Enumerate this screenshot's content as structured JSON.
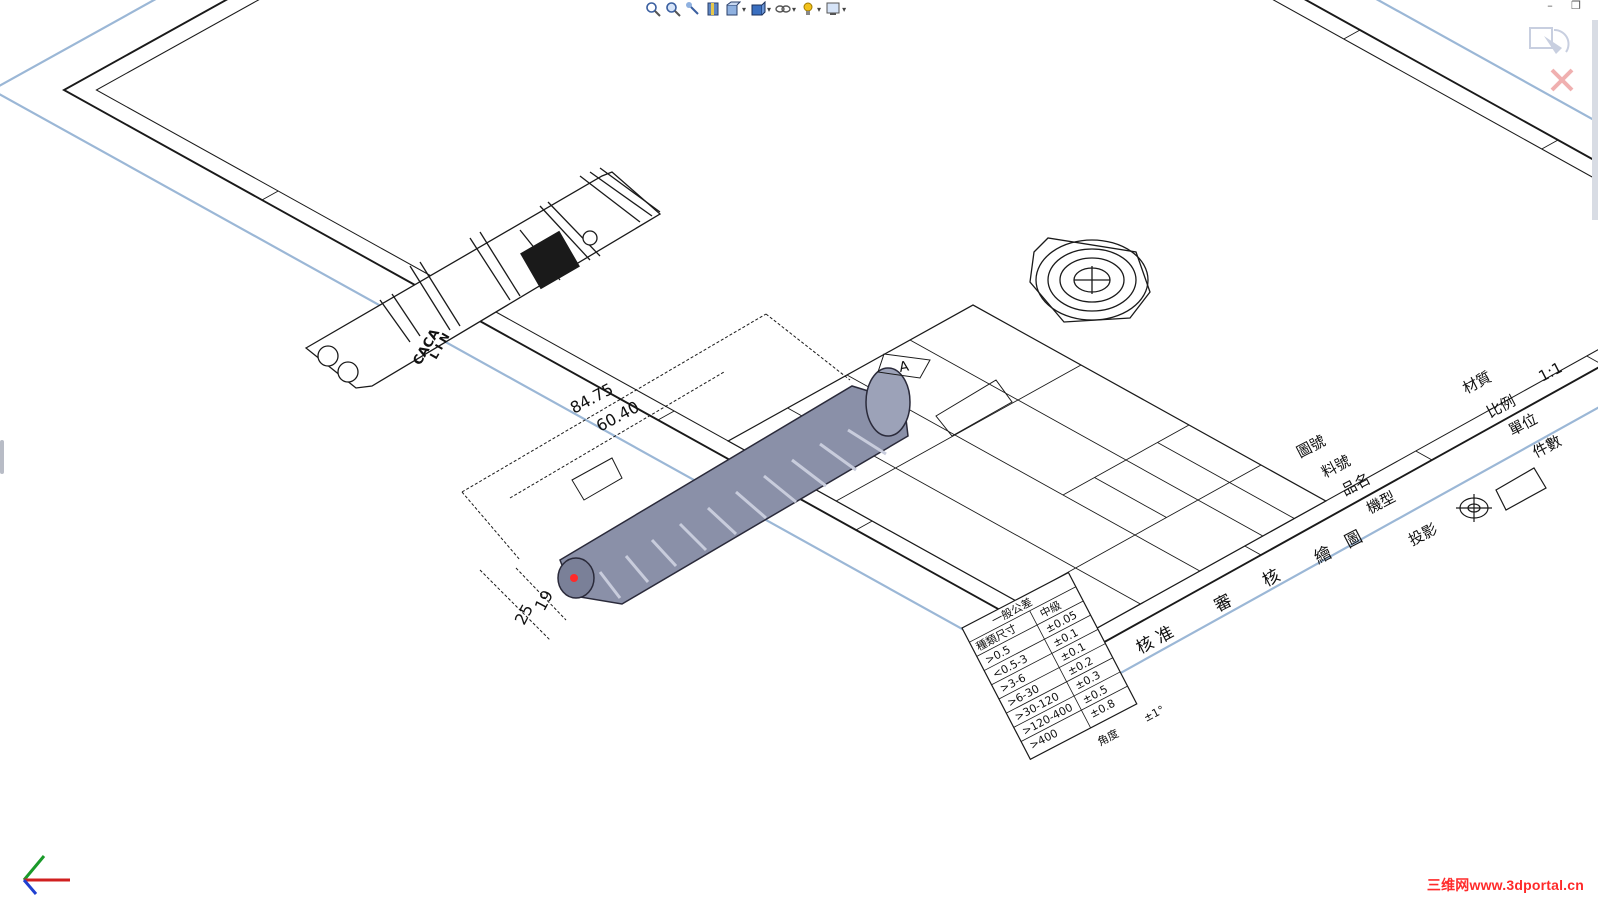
{
  "toolbar": {
    "buttons": [
      {
        "icon": "zoom-to-fit-icon",
        "dropdown": false
      },
      {
        "icon": "zoom-area-icon",
        "dropdown": false
      },
      {
        "icon": "previous-view-icon",
        "dropdown": false
      },
      {
        "icon": "section-view-icon",
        "dropdown": false
      },
      {
        "icon": "view-orientation-icon",
        "dropdown": true
      },
      {
        "icon": "display-style-icon",
        "dropdown": true
      },
      {
        "icon": "hide-show-items-icon",
        "dropdown": true
      },
      {
        "icon": "lights-icon",
        "dropdown": true
      },
      {
        "icon": "view-settings-icon",
        "dropdown": true
      }
    ],
    "dropdown_glyph": "▾"
  },
  "window": {
    "minimize": "–",
    "restore": "❐"
  },
  "drawing": {
    "dimensions": {
      "overall_length": "84.75",
      "body_length": "60.40",
      "diameter_small": "19",
      "diameter_large": "25"
    },
    "datum": "A",
    "part_marking": [
      "CACA",
      "L I N"
    ],
    "title_block": {
      "material_label": "材質",
      "material_value": "1:1",
      "scale_label": "比例",
      "unit_label": "單位",
      "quantity_label": "件數",
      "drawing_no_label": "圖號",
      "part_no_label": "料號",
      "name_label": "品名",
      "model_label": "機型",
      "projection_label": "投影",
      "draw_label": "繪 圖",
      "check_label": "審 核",
      "approve_label": "核 准"
    },
    "tolerance_table": {
      "title": "一般公差",
      "headers": [
        "種類尺寸",
        "中級"
      ],
      "rows": [
        [
          ">0.5",
          "±0.05"
        ],
        [
          "<0.5-3",
          "±0.1"
        ],
        [
          ">3-6",
          "±0.1"
        ],
        [
          ">6-30",
          "±0.2"
        ],
        [
          ">30-120",
          "±0.3"
        ],
        [
          ">120-400",
          "±0.5"
        ],
        [
          ">400",
          "±0.8"
        ],
        [
          "角度",
          "±1°"
        ]
      ]
    }
  },
  "watermark": "三维网www.3dportal.cn",
  "colors": {
    "accent": "#ff2a2a",
    "sheet_line": "#1a1a1a",
    "border_blue": "#9bb7d6",
    "part_fill": "#8a90a8"
  }
}
